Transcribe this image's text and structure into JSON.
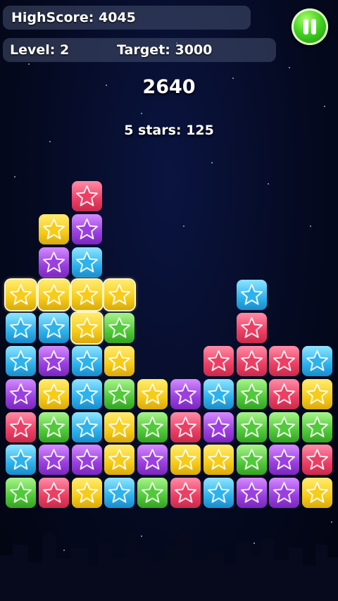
{
  "hud": {
    "highscore": "HighScore: 4045",
    "level": "Level: 2",
    "target": "Target: 3000",
    "score": "2640",
    "bonus": "5 stars: 125"
  },
  "colors": {
    "red": "#ec3f64",
    "yellow": "#f6cc19",
    "purple": "#9a3fe0",
    "blue": "#2eb2ec",
    "green": "#52c93a"
  },
  "board": {
    "columns": 10,
    "rows": 10,
    "grid": [
      [
        "",
        "",
        "R",
        "",
        "",
        "",
        "",
        "",
        "",
        ""
      ],
      [
        "",
        "Y",
        "P",
        "",
        "",
        "",
        "",
        "",
        "",
        ""
      ],
      [
        "",
        "P",
        "B",
        "",
        "",
        "",
        "",
        "",
        "",
        ""
      ],
      [
        "Y*",
        "Y*",
        "Y*",
        "Y*",
        "",
        "",
        "",
        "B",
        "",
        ""
      ],
      [
        "B",
        "B",
        "Y*",
        "G",
        "",
        "",
        "",
        "R",
        "",
        ""
      ],
      [
        "B",
        "P",
        "B",
        "Y",
        "",
        "",
        "R",
        "R",
        "R",
        "B"
      ],
      [
        "P",
        "Y",
        "B",
        "G",
        "Y",
        "P",
        "B",
        "G",
        "R",
        "Y"
      ],
      [
        "R",
        "G",
        "B",
        "Y",
        "G",
        "R",
        "P",
        "G",
        "G",
        "G"
      ],
      [
        "B",
        "P",
        "P",
        "Y",
        "P",
        "Y",
        "Y",
        "G",
        "P",
        "R"
      ],
      [
        "G",
        "R",
        "Y",
        "B",
        "G",
        "R",
        "B",
        "P",
        "P",
        "Y"
      ]
    ]
  }
}
